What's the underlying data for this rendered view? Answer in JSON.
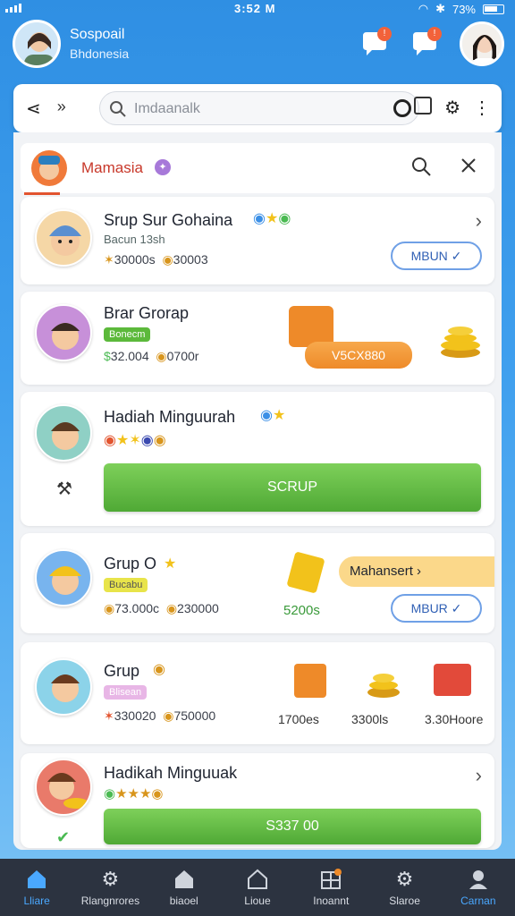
{
  "status": {
    "time": "3:52 M",
    "battery": "73%"
  },
  "profile": {
    "name": "Sospoail",
    "location": "Bhdonesia"
  },
  "search": {
    "placeholder": "Imdaanalk"
  },
  "panel": {
    "title": "Mamasia"
  },
  "cards": [
    {
      "title": "Srup Sur Gohaina",
      "sub": "Bacun 13sh",
      "stat1": "30000s",
      "stat2": "30003",
      "button": "MBUN"
    },
    {
      "title": "Brar Grorap",
      "tag": "Bonecm",
      "stat1": "32.004",
      "stat2": "0700r",
      "reward": "V5CX880"
    },
    {
      "title": "Hadiah Minguurah",
      "button": "SCRUP"
    },
    {
      "title": "Grup O",
      "tag": "Bucabu",
      "stat1": "73.000c",
      "stat2": "230000",
      "badge": "Mahansert",
      "amount": "5200s",
      "button": "MBUR"
    },
    {
      "title": "Grup",
      "tag": "Blisean",
      "stat1": "330020",
      "stat2": "750000",
      "rewards": [
        "1700es",
        "3300ls",
        "3.30Hoore"
      ]
    },
    {
      "title": "Hadikah Minguuak",
      "button": "S337 00"
    }
  ],
  "nav": [
    {
      "label": "Lliare",
      "icon": "home-icon"
    },
    {
      "label": "Rlangnrores",
      "icon": "gear-icon"
    },
    {
      "label": "biaoel",
      "icon": "house-icon"
    },
    {
      "label": "Lioue",
      "icon": "building-icon"
    },
    {
      "label": "Inoannt",
      "icon": "grid-icon"
    },
    {
      "label": "Slaroe",
      "icon": "share-icon"
    },
    {
      "label": "Carnan",
      "icon": "user-icon"
    }
  ],
  "colors": {
    "accent": "#2f8fe3",
    "green": "#5cb93b",
    "orange": "#ee8a29",
    "nav_bg": "#2c3340"
  }
}
